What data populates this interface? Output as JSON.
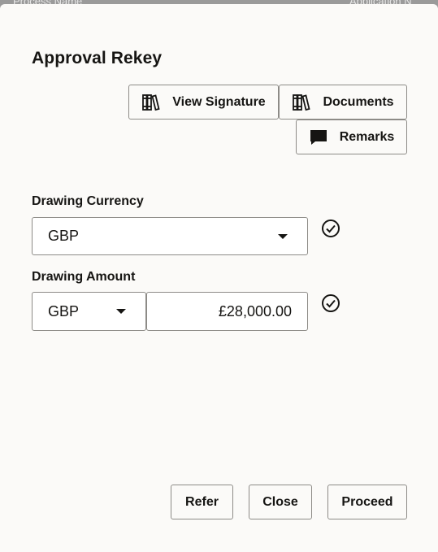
{
  "backdrop": {
    "col1": "Process Name",
    "col2": "Application N"
  },
  "dialog": {
    "title": "Approval Rekey"
  },
  "toolbar": {
    "view_signature_label": "View Signature",
    "documents_label": "Documents",
    "remarks_label": "Remarks"
  },
  "fields": {
    "drawing_currency": {
      "label": "Drawing Currency",
      "value": "GBP",
      "validated": true
    },
    "drawing_amount": {
      "label": "Drawing Amount",
      "currency": "GBP",
      "value": "£28,000.00",
      "validated": true
    }
  },
  "footer": {
    "refer_label": "Refer",
    "close_label": "Close",
    "proceed_label": "Proceed"
  },
  "icons": {
    "view_signature": "books-icon",
    "documents": "books-icon",
    "remarks": "speech-bubble-icon",
    "validated": "check-circle-icon",
    "dropdown": "caret-down-icon"
  },
  "colors": {
    "dialog_bg": "#fbfaf8",
    "text": "#161513",
    "border": "#8d8b87",
    "overlay": "#7b7b7b"
  }
}
